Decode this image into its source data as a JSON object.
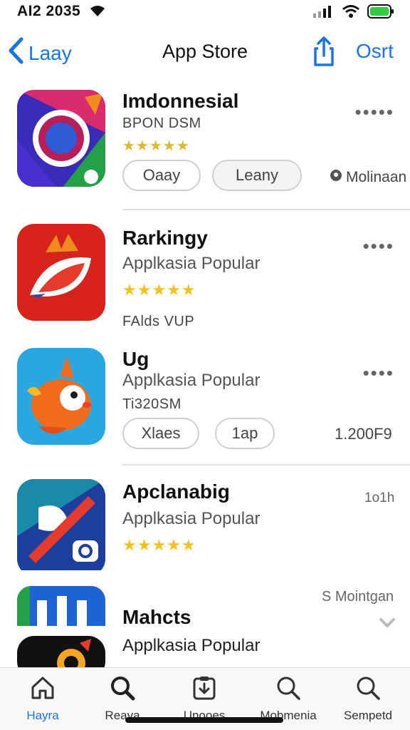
{
  "status_bar": {
    "time": "AI2 2035"
  },
  "nav": {
    "back_label": "Laay",
    "title": "App Store",
    "sort_label": "Osrt"
  },
  "apps": [
    {
      "name": "Imdonnesial",
      "subtitle": "BPON DSM",
      "rating": "★★★★★",
      "pills": [
        "Oaay",
        "Leany"
      ],
      "side_text": "Molinaan",
      "more": "•••••"
    },
    {
      "name": "Rarkingy",
      "subtitle": "Applkasia Popular",
      "rating": "★★★★★",
      "extra": "FAlds VUP",
      "more": "••••"
    },
    {
      "name": "Ug",
      "subtitle": "Applkasia Popular",
      "extra": "Ti320SM",
      "pills": [
        "Xlaes",
        "1ap"
      ],
      "side_text": "1.200F9",
      "more": "••••"
    },
    {
      "name": "Apclanabig",
      "subtitle": "Applkasia Popular",
      "rating": "★★★★★",
      "side_text": "1o1h"
    },
    {
      "name": "Mahcts",
      "subtitle": "Applkasia Popular",
      "side_text": "S Mointgan"
    }
  ],
  "tabs": [
    {
      "label": "Hayra",
      "icon": "home-icon",
      "active": true
    },
    {
      "label": "Reaya",
      "icon": "search-icon",
      "active": false
    },
    {
      "label": "Unooes",
      "icon": "updates-icon",
      "active": false
    },
    {
      "label": "Mobmenia",
      "icon": "search-icon",
      "active": false
    },
    {
      "label": "Sempetd",
      "icon": "search-icon",
      "active": false
    }
  ],
  "colors": {
    "accent": "#1a73e8",
    "star": "#f6c21a"
  }
}
